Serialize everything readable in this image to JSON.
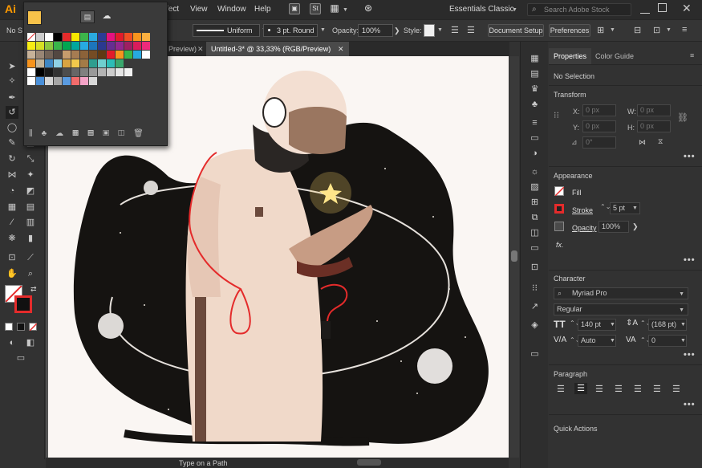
{
  "app": {
    "logo": "Ai"
  },
  "menu": {
    "items": [
      "fect",
      "View",
      "Window",
      "Help"
    ],
    "icon_st": "St",
    "workspace": "Essentials Classic"
  },
  "search": {
    "placeholder": "Search Adobe Stock"
  },
  "control": {
    "no_selection": "No S",
    "stroke_style": "Uniform",
    "brush": "3 pt. Round",
    "opacity_label": "Opacity:",
    "opacity_value": "100%",
    "style_label": "Style:",
    "doc_setup": "Document Setup",
    "preferences": "Preferences"
  },
  "tabs": {
    "prev": "Preview)",
    "active": "Untitled-3* @ 33,33% (RGB/Preview)"
  },
  "status": {
    "text": "Type on a Path"
  },
  "properties": {
    "tab_properties": "Properties",
    "tab_color_guide": "Color Guide",
    "selection": "No Selection",
    "transform_title": "Transform",
    "x_label": "X:",
    "y_label": "Y:",
    "w_label": "W:",
    "h_label": "H:",
    "zero": "0 px",
    "angle_zero": "0°",
    "appearance_title": "Appearance",
    "fill_label": "Fill",
    "stroke_label": "Stroke",
    "stroke_value": "5 pt",
    "opacity_label": "Opacity",
    "opacity_value": "100%",
    "fx": "fx.",
    "character_title": "Character",
    "font_family": "Myriad Pro",
    "font_style": "Regular",
    "font_size": "140 pt",
    "leading": "(168 pt)",
    "kerning": "Auto",
    "tracking": "0",
    "paragraph_title": "Paragraph",
    "quick_actions_title": "Quick Actions",
    "more": "•••"
  },
  "colors": {
    "fill_swatch": "#f7c24a",
    "accent": "#e42b2b"
  }
}
